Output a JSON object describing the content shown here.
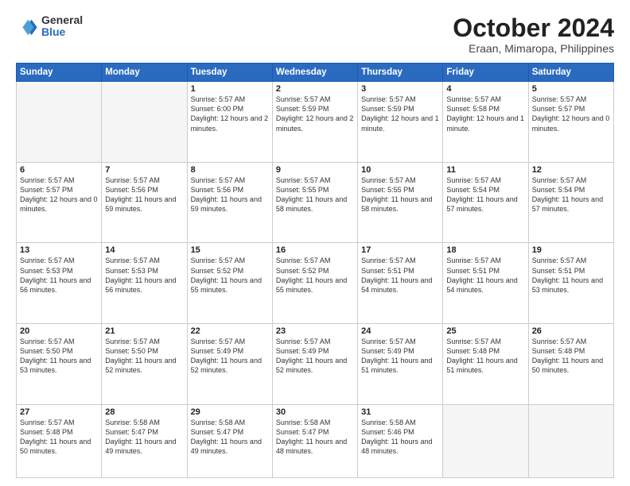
{
  "logo": {
    "general": "General",
    "blue": "Blue"
  },
  "header": {
    "month": "October 2024",
    "location": "Eraan, Mimaropa, Philippines"
  },
  "days_of_week": [
    "Sunday",
    "Monday",
    "Tuesday",
    "Wednesday",
    "Thursday",
    "Friday",
    "Saturday"
  ],
  "weeks": [
    [
      {
        "day": "",
        "info": ""
      },
      {
        "day": "",
        "info": ""
      },
      {
        "day": "1",
        "info": "Sunrise: 5:57 AM\nSunset: 6:00 PM\nDaylight: 12 hours and 2 minutes."
      },
      {
        "day": "2",
        "info": "Sunrise: 5:57 AM\nSunset: 5:59 PM\nDaylight: 12 hours and 2 minutes."
      },
      {
        "day": "3",
        "info": "Sunrise: 5:57 AM\nSunset: 5:59 PM\nDaylight: 12 hours and 1 minute."
      },
      {
        "day": "4",
        "info": "Sunrise: 5:57 AM\nSunset: 5:58 PM\nDaylight: 12 hours and 1 minute."
      },
      {
        "day": "5",
        "info": "Sunrise: 5:57 AM\nSunset: 5:57 PM\nDaylight: 12 hours and 0 minutes."
      }
    ],
    [
      {
        "day": "6",
        "info": "Sunrise: 5:57 AM\nSunset: 5:57 PM\nDaylight: 12 hours and 0 minutes."
      },
      {
        "day": "7",
        "info": "Sunrise: 5:57 AM\nSunset: 5:56 PM\nDaylight: 11 hours and 59 minutes."
      },
      {
        "day": "8",
        "info": "Sunrise: 5:57 AM\nSunset: 5:56 PM\nDaylight: 11 hours and 59 minutes."
      },
      {
        "day": "9",
        "info": "Sunrise: 5:57 AM\nSunset: 5:55 PM\nDaylight: 11 hours and 58 minutes."
      },
      {
        "day": "10",
        "info": "Sunrise: 5:57 AM\nSunset: 5:55 PM\nDaylight: 11 hours and 58 minutes."
      },
      {
        "day": "11",
        "info": "Sunrise: 5:57 AM\nSunset: 5:54 PM\nDaylight: 11 hours and 57 minutes."
      },
      {
        "day": "12",
        "info": "Sunrise: 5:57 AM\nSunset: 5:54 PM\nDaylight: 11 hours and 57 minutes."
      }
    ],
    [
      {
        "day": "13",
        "info": "Sunrise: 5:57 AM\nSunset: 5:53 PM\nDaylight: 11 hours and 56 minutes."
      },
      {
        "day": "14",
        "info": "Sunrise: 5:57 AM\nSunset: 5:53 PM\nDaylight: 11 hours and 56 minutes."
      },
      {
        "day": "15",
        "info": "Sunrise: 5:57 AM\nSunset: 5:52 PM\nDaylight: 11 hours and 55 minutes."
      },
      {
        "day": "16",
        "info": "Sunrise: 5:57 AM\nSunset: 5:52 PM\nDaylight: 11 hours and 55 minutes."
      },
      {
        "day": "17",
        "info": "Sunrise: 5:57 AM\nSunset: 5:51 PM\nDaylight: 11 hours and 54 minutes."
      },
      {
        "day": "18",
        "info": "Sunrise: 5:57 AM\nSunset: 5:51 PM\nDaylight: 11 hours and 54 minutes."
      },
      {
        "day": "19",
        "info": "Sunrise: 5:57 AM\nSunset: 5:51 PM\nDaylight: 11 hours and 53 minutes."
      }
    ],
    [
      {
        "day": "20",
        "info": "Sunrise: 5:57 AM\nSunset: 5:50 PM\nDaylight: 11 hours and 53 minutes."
      },
      {
        "day": "21",
        "info": "Sunrise: 5:57 AM\nSunset: 5:50 PM\nDaylight: 11 hours and 52 minutes."
      },
      {
        "day": "22",
        "info": "Sunrise: 5:57 AM\nSunset: 5:49 PM\nDaylight: 11 hours and 52 minutes."
      },
      {
        "day": "23",
        "info": "Sunrise: 5:57 AM\nSunset: 5:49 PM\nDaylight: 11 hours and 52 minutes."
      },
      {
        "day": "24",
        "info": "Sunrise: 5:57 AM\nSunset: 5:49 PM\nDaylight: 11 hours and 51 minutes."
      },
      {
        "day": "25",
        "info": "Sunrise: 5:57 AM\nSunset: 5:48 PM\nDaylight: 11 hours and 51 minutes."
      },
      {
        "day": "26",
        "info": "Sunrise: 5:57 AM\nSunset: 5:48 PM\nDaylight: 11 hours and 50 minutes."
      }
    ],
    [
      {
        "day": "27",
        "info": "Sunrise: 5:57 AM\nSunset: 5:48 PM\nDaylight: 11 hours and 50 minutes."
      },
      {
        "day": "28",
        "info": "Sunrise: 5:58 AM\nSunset: 5:47 PM\nDaylight: 11 hours and 49 minutes."
      },
      {
        "day": "29",
        "info": "Sunrise: 5:58 AM\nSunset: 5:47 PM\nDaylight: 11 hours and 49 minutes."
      },
      {
        "day": "30",
        "info": "Sunrise: 5:58 AM\nSunset: 5:47 PM\nDaylight: 11 hours and 48 minutes."
      },
      {
        "day": "31",
        "info": "Sunrise: 5:58 AM\nSunset: 5:46 PM\nDaylight: 11 hours and 48 minutes."
      },
      {
        "day": "",
        "info": ""
      },
      {
        "day": "",
        "info": ""
      }
    ]
  ]
}
